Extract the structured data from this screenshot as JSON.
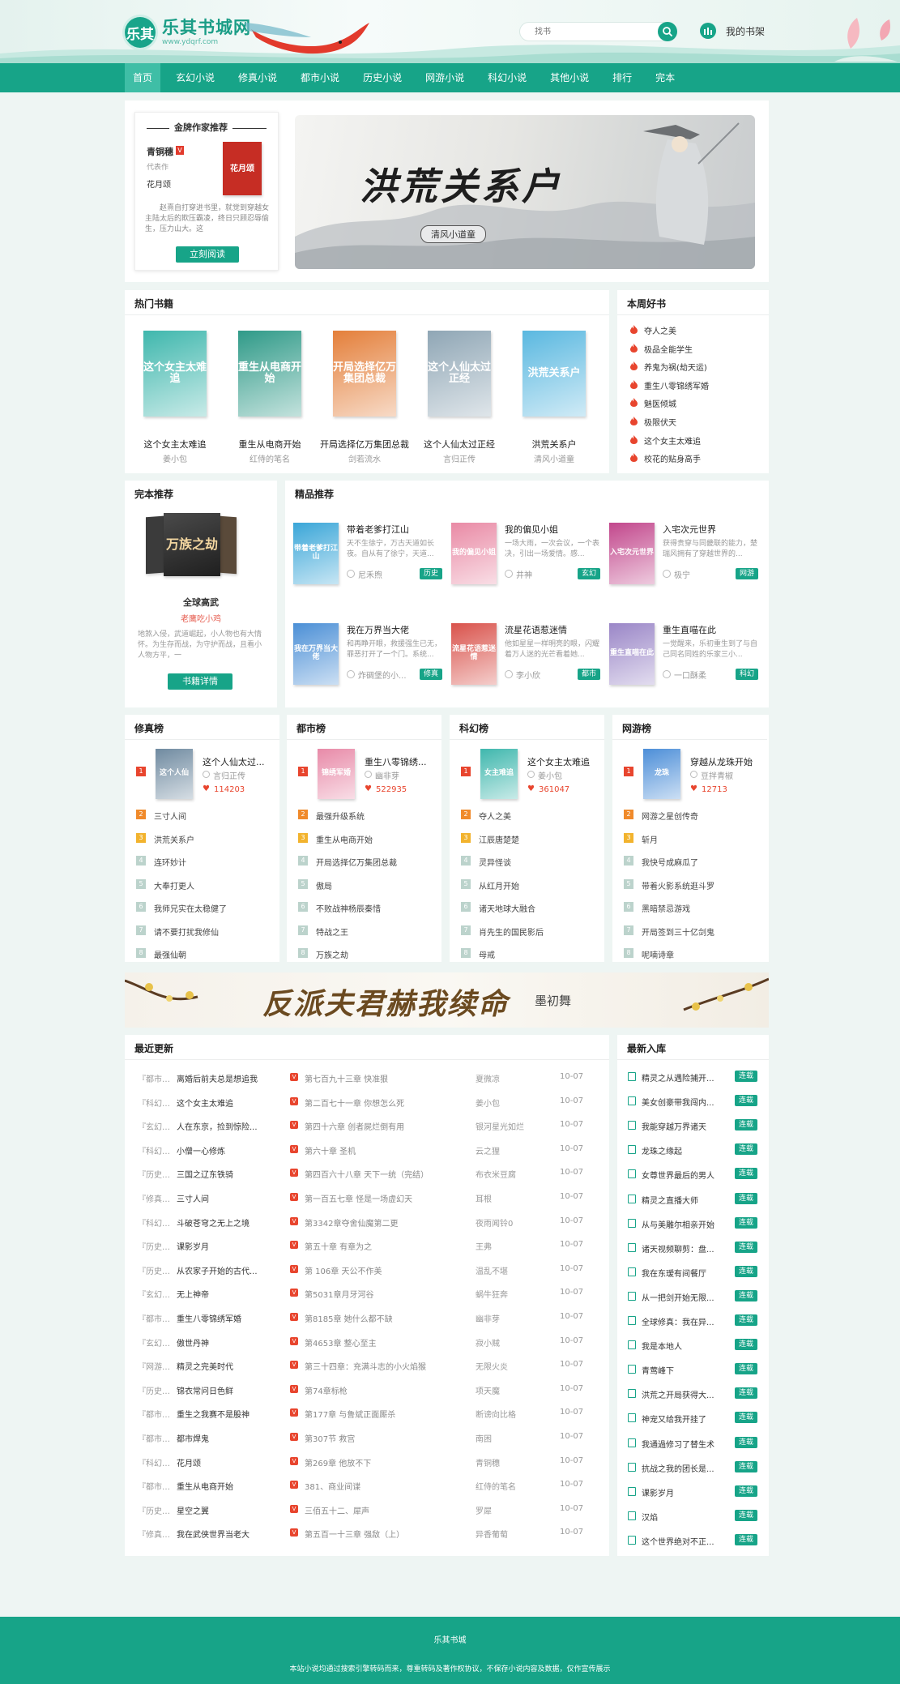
{
  "header": {
    "logo_mark": "乐其",
    "logo_name": "乐其书城网",
    "logo_url": "www.ydqrf.com",
    "search_placeholder": "找书",
    "shelf_label": "我的书架"
  },
  "nav": [
    "首页",
    "玄幻小说",
    "修真小说",
    "都市小说",
    "历史小说",
    "网游小说",
    "科幻小说",
    "其他小说",
    "排行",
    "完本"
  ],
  "author_rec": {
    "title": "金牌作家推荐",
    "author": "青铜穗",
    "badge": "V",
    "rep_label": "代表作",
    "work": "花月颂",
    "cover_title": "花月颂",
    "desc": "赵熹自打穿进书里，就觉到穿越女主陆太后的欺压霸凌，终日只顾忍辱偷生，压力山大。这",
    "button": "立刻阅读"
  },
  "banner": {
    "title": "洪荒关系户",
    "author": "清风小道童"
  },
  "hot": {
    "title": "热门书籍",
    "books": [
      {
        "cover": "这个女主太难追",
        "name": "这个女主太难追",
        "author": "姜小包",
        "color": "#3fb7ad"
      },
      {
        "cover": "重生从电商开始",
        "name": "重生从电商开始",
        "author": "红侍的笔名",
        "color": "#2f9a88"
      },
      {
        "cover": "开局选择亿万集团总裁",
        "name": "开局选择亿万集团总裁",
        "author": "剑若流水",
        "color": "#e47f3a"
      },
      {
        "cover": "这个人仙太过正经",
        "name": "这个人仙太过正经",
        "author": "言归正传",
        "color": "#8fa6b5"
      },
      {
        "cover": "洪荒关系户",
        "name": "洪荒关系户",
        "author": "清风小道童",
        "color": "#5ab8e0"
      }
    ]
  },
  "weekly": {
    "title": "本周好书",
    "items": [
      "夺人之美",
      "极品全能学生",
      "养鬼为祸(劫天运)",
      "重生八零锦绣军婚",
      "魅医倾城",
      "极限伏天",
      "这个女主太难追",
      "校花的贴身高手"
    ]
  },
  "finished": {
    "title": "完本推荐",
    "cover": "万族之劫",
    "name": "全球高武",
    "author": "老鹰吃小鸡",
    "desc": "地煞入侵，武道崛起，小人物也有大情怀。为生存而战，为守护而战，且看小人物方平，一",
    "button": "书籍详情"
  },
  "premium": {
    "title": "精品推荐",
    "books": [
      {
        "cover": "带着老爹打江山",
        "name": "带着老爹打江山",
        "desc": "天不生徐宁，万古天道如长夜。自从有了徐宁，天道...",
        "author": "尼禾煦",
        "tag": "历史",
        "color": "#3aa6d8"
      },
      {
        "cover": "我的偏见小姐",
        "name": "我的偏见小姐",
        "desc": "一场大雨，一次会议，一个表决，引出一场爱情。感...",
        "author": "井神",
        "tag": "玄幻",
        "color": "#e98aa5"
      },
      {
        "cover": "入宅次元世界",
        "name": "入宅次元世界",
        "desc": "获得贵穿与同畿联的能力，楚瑞风拥有了穿越世界的...",
        "author": "极宁",
        "tag": "网游",
        "color": "#c2478c"
      },
      {
        "cover": "我在万界当大佬",
        "name": "我在万界当大佬",
        "desc": "和再睁开眼，救援强生已无，罪恶打开了一个门。系统...",
        "author": "炸碉堡的小...",
        "tag": "修真",
        "color": "#4b8fd6"
      },
      {
        "cover": "流星花语惹迷情",
        "name": "流星花语惹迷情",
        "desc": "他如星星一样明亮的眼，闪耀着万人迷的光芒看着她...",
        "author": "李小欣",
        "tag": "都市",
        "color": "#d9524b"
      },
      {
        "cover": "重生直喵在此",
        "name": "重生直喵在此",
        "desc": "一觉醒来，乐初重生到了与自己同名同姓的乐家三小...",
        "author": "一口酥柔",
        "tag": "科幻",
        "color": "#9a86c7"
      }
    ]
  },
  "rankings": [
    {
      "title": "修真榜",
      "top": {
        "name": "这个人仙太过...",
        "author": "言归正传",
        "heat": "114203",
        "cover": "这个人仙",
        "color": "#6f8aa0"
      },
      "items": [
        "三寸人间",
        "洪荒关系户",
        "连环妙计",
        "大奉打更人",
        "我师兄实在太稳健了",
        "请不要打扰我修仙",
        "最强仙朝"
      ]
    },
    {
      "title": "都市榜",
      "top": {
        "name": "重生八零锦绣...",
        "author": "幽非芽",
        "heat": "522935",
        "cover": "锦绣军婚",
        "color": "#e88aa8"
      },
      "items": [
        "最强升级系统",
        "重生从电商开始",
        "开局选择亿万集团总裁",
        "傲局",
        "不败战神杨辰秦惜",
        "特战之王",
        "万族之劫"
      ]
    },
    {
      "title": "科幻榜",
      "top": {
        "name": "这个女主太难追",
        "author": "姜小包",
        "heat": "361047",
        "cover": "女主难追",
        "color": "#3fb7ad"
      },
      "items": [
        "夺人之美",
        "江辰唐楚楚",
        "灵异怪谈",
        "从红月开始",
        "诸天地球大融合",
        "肖先生的国民影后",
        "母戒"
      ]
    },
    {
      "title": "网游榜",
      "top": {
        "name": "穿越从龙珠开始",
        "author": "豆拌青椒",
        "heat": "12713",
        "cover": "龙珠",
        "color": "#4c8ed8"
      },
      "items": [
        "网游之星创传奇",
        "斩月",
        "我快号成麻瓜了",
        "带着火影系统逛斗罗",
        "黑暗禁忌游戏",
        "开局签到三十亿剑鬼",
        "呢喃诗章"
      ]
    }
  ],
  "banner2": {
    "title": "反派夫君赫我续命",
    "author": "墨初舞"
  },
  "recent": {
    "title": "最近更新",
    "rows": [
      [
        "『都市小说』",
        "离婚后前夫总是想追我",
        "第七百九十三章 快准狠",
        "夏微凉",
        "10-07"
      ],
      [
        "『科幻小说』",
        "这个女主太难追",
        "第二百七十一章 你想怎么死",
        "姜小包",
        "10-07"
      ],
      [
        "『玄幻小说』",
        "人在东京，捡到惊险...",
        "第四十六章 创者屍烂倒有用",
        "银河星光如烂",
        "10-07"
      ],
      [
        "『科幻小说』",
        "小僧一心修炼",
        "第六十章 圣机",
        "云之狸",
        "10-07"
      ],
      [
        "『历史小说』",
        "三国之辽东铁骑",
        "第四百六十八章 天下一统（完结）",
        "布衣米豆腐",
        "10-07"
      ],
      [
        "『修真小说』",
        "三寸人间",
        "第一百五七章 怪是一场虚幻天",
        "耳根",
        "10-07"
      ],
      [
        "『科幻小说』",
        "斗破苍穹之无上之境",
        "第3342章夺舍仙魔第二更",
        "夜雨闻铃0",
        "10-07"
      ],
      [
        "『历史小说』",
        "课影岁月",
        "第五十章 有章为之",
        "王弗",
        "10-07"
      ],
      [
        "『历史小说』",
        "从农家子开始的古代...",
        "第 106章 天公不作美",
        "温乱不堪",
        "10-07"
      ],
      [
        "『玄幻小说』",
        "无上神帝",
        "第5031章月牙河谷",
        "蜗牛狂奔",
        "10-07"
      ],
      [
        "『都市小说』",
        "重生八零锦绣军婚",
        "第8185章 她什么都不缺",
        "幽非芽",
        "10-07"
      ],
      [
        "『玄幻小说』",
        "傲世丹神",
        "第4653章 整心至主",
        "寂小贼",
        "10-07"
      ],
      [
        "『网游小说』",
        "精灵之完美时代",
        "第三十四章：充满斗志的小火焰猴",
        "无限火炎",
        "10-07"
      ],
      [
        "『历史小说』",
        "锦衣常问日色鲜",
        "第74章标枪",
        "项天魔",
        "10-07"
      ],
      [
        "『都市小说』",
        "重生之我赛不是股神",
        "第177章 与鲁斌正面厮杀",
        "断谤向比格",
        "10-07"
      ],
      [
        "『都市小说』",
        "都市焊鬼",
        "第307节 救宫",
        "南困",
        "10-07"
      ],
      [
        "『科幻小说』",
        "花月颂",
        "第269章 他放不下",
        "青铜穗",
        "10-07"
      ],
      [
        "『都市小说』",
        "重生从电商开始",
        "381、商业间谍",
        "红侍的笔名",
        "10-07"
      ],
      [
        "『历史小说』",
        "星空之翼",
        "三佰五十二、犀声",
        "罗犀",
        "10-07"
      ],
      [
        "『修真小说』",
        "我在武侠世界当老大",
        "第五百一十三章 强敌（上）",
        "异香葡萄",
        "10-07"
      ]
    ]
  },
  "newest": {
    "title": "最新入库",
    "status": "连载",
    "items": [
      "精灵之从遇险捕开...",
      "美女创豪带我闯内...",
      "我能穿越万界诸天",
      "龙珠之缘起",
      "女尊世界最后的男人",
      "精灵之直播大师",
      "从与美雕尔相亲开始",
      "诸天视频聊剪：盘...",
      "我在东瑷有间餐厅",
      "从一把剑开始无限...",
      "全球修真：我在异...",
      "我是本地人",
      "青莺峰下",
      "洪荒之开局获得大...",
      "神宠又给我开挂了",
      "我通過修习了替生术",
      "抗战之我的团长是...",
      "课影岁月",
      "汉焰",
      "这个世界绝对不正..."
    ]
  },
  "footer": {
    "name": "乐其书城",
    "notice": "本站小说均通过搜索引擎转码而来，尊重转码及著作权协议，不保存小说内容及数据，仅作宣传展示"
  }
}
